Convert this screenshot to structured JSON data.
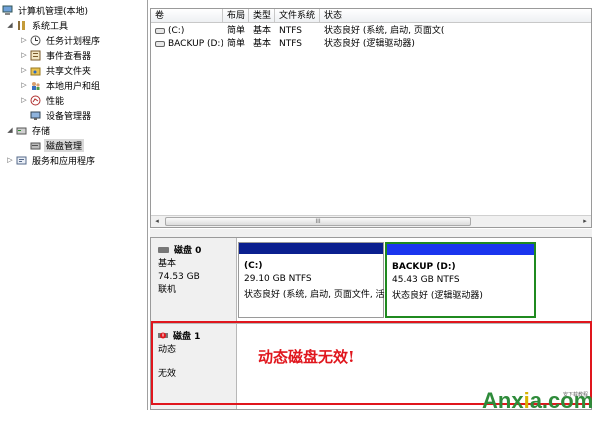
{
  "tree": {
    "items": [
      {
        "label": "计算机管理(本地)",
        "icon": "computer-mgmt-icon",
        "expander": ""
      },
      {
        "label": "系统工具",
        "icon": "tools-icon",
        "expander": "◢"
      },
      {
        "label": "任务计划程序",
        "icon": "clock-icon",
        "expander": "▷"
      },
      {
        "label": "事件查看器",
        "icon": "event-log-icon",
        "expander": "▷"
      },
      {
        "label": "共享文件夹",
        "icon": "shared-folder-icon",
        "expander": "▷"
      },
      {
        "label": "本地用户和组",
        "icon": "users-icon",
        "expander": "▷"
      },
      {
        "label": "性能",
        "icon": "performance-icon",
        "expander": "▷"
      },
      {
        "label": "设备管理器",
        "icon": "device-manager-icon",
        "expander": ""
      },
      {
        "label": "存储",
        "icon": "storage-icon",
        "expander": "◢"
      },
      {
        "label": "磁盘管理",
        "icon": "disk-management-icon",
        "expander": ""
      },
      {
        "label": "服务和应用程序",
        "icon": "services-icon",
        "expander": "▷"
      }
    ],
    "selected_index": 9
  },
  "volumes": {
    "columns": [
      "卷",
      "布局",
      "类型",
      "文件系统",
      "状态"
    ],
    "rows": [
      {
        "volume": "(C:)",
        "layout": "简单",
        "type": "基本",
        "fs": "NTFS",
        "status": "状态良好 (系统, 启动, 页面文("
      },
      {
        "volume": "BACKUP (D:)",
        "layout": "简单",
        "type": "基本",
        "fs": "NTFS",
        "status": "状态良好 (逻辑驱动器)"
      }
    ],
    "scroll_left": "◂",
    "scroll_right": "▸",
    "scroll_grip": "III"
  },
  "disk0": {
    "name": "磁盘 0",
    "type": "基本",
    "size": "74.53 GB",
    "state": "联机",
    "partitions": [
      {
        "name": "(C:)",
        "size": "29.10 GB NTFS",
        "status": "状态良好 (系统, 启动, 页面文件, 活",
        "bar_color": "#0a1f8f"
      },
      {
        "name": "BACKUP  (D:)",
        "size": "45.43 GB NTFS",
        "status": "状态良好 (逻辑驱动器)",
        "bar_color": "#1a35ee",
        "highlight_color": "#1f8a1f"
      }
    ]
  },
  "disk1": {
    "name": "磁盘 1",
    "type": "动态",
    "state": "无效"
  },
  "annotation": {
    "message": "动态磁盘无效!",
    "color": "#e0161d"
  },
  "watermark": {
    "brand_a": "Anx",
    "brand_x": "i",
    "brand_b": "a.com",
    "small": "安下载教程"
  }
}
